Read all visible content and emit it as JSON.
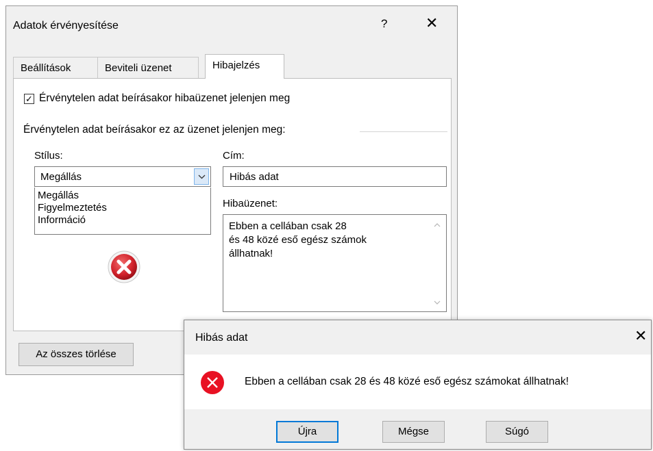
{
  "dialog": {
    "title": "Adatok érvényesítése",
    "help": "?",
    "close": "✕",
    "tabs": [
      {
        "label": "Beállítások"
      },
      {
        "label": "Beviteli üzenet"
      },
      {
        "label": "Hibajelzés"
      }
    ],
    "show_error_checkbox": {
      "checked": true,
      "label": "Érvénytelen adat beírásakor hibaüzenet jelenjen meg"
    },
    "group_label": "Érvénytelen adat beírásakor ez az üzenet jelenjen meg:",
    "style_label": "Stílus:",
    "style_value": "Megállás",
    "style_options": [
      "Megállás",
      "Figyelmeztetés",
      "Információ"
    ],
    "title_label": "Cím:",
    "title_value": "Hibás adat",
    "message_label": "Hibaüzenet:",
    "message_lines": [
      "Ebben a cellában csak 28",
      "és 48 közé eső egész számok",
      "állhatnak!"
    ],
    "clear_all_button": "Az összes törlése"
  },
  "alert": {
    "title": "Hibás adat",
    "close": "✕",
    "message": "Ebben a cellában csak 28 és 48 közé eső egész számokat állhatnak!",
    "buttons": {
      "retry": "Újra",
      "cancel": "Mégse",
      "help": "Súgó"
    }
  },
  "icons": {
    "error_color": "#e81123",
    "combo_accent": "#7eb4ea"
  }
}
